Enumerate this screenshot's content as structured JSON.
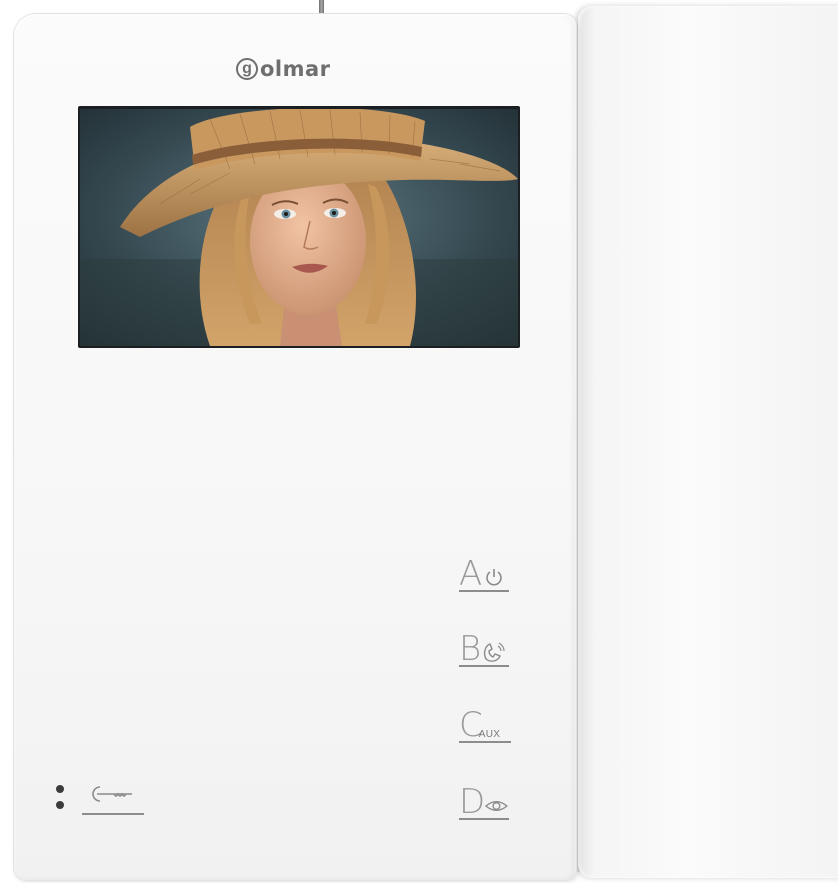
{
  "brand": {
    "logo_mark": "g",
    "logo_text": "olmar"
  },
  "buttons": [
    {
      "letter": "A",
      "icon": "power-icon"
    },
    {
      "letter": "B",
      "icon": "handset-icon"
    },
    {
      "letter": "C",
      "icon": "aux-label",
      "label": "AUX"
    },
    {
      "letter": "D",
      "icon": "camera-eye-icon"
    }
  ],
  "door_release": {
    "icon": "key-icon"
  },
  "leds": 2,
  "screen": {
    "content": "woman-portrait-photo"
  }
}
